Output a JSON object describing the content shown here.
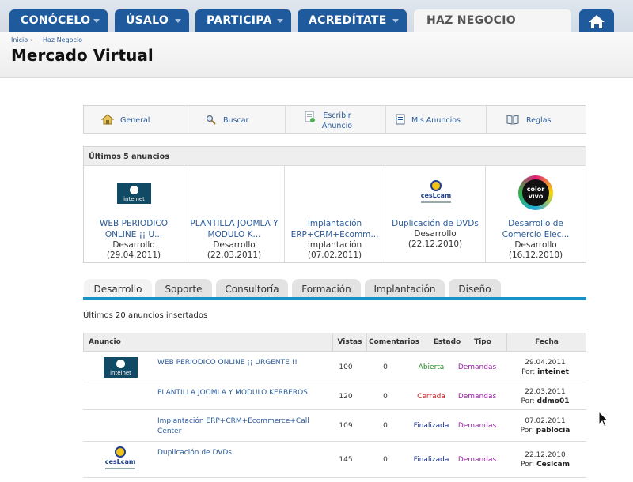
{
  "nav": {
    "tabs": [
      {
        "label": "CONÓCELO"
      },
      {
        "label": "ÚSALO"
      },
      {
        "label": "PARTICIPA"
      },
      {
        "label": "ACREDÍTATE"
      },
      {
        "label": "HAZ NEGOCIO"
      }
    ],
    "home_icon": "home-icon"
  },
  "breadcrumb": [
    "Inicio",
    "Haz Negocio"
  ],
  "page_title": "Mercado Virtual",
  "toolbar": {
    "items": [
      {
        "label": "General",
        "icon": "home-icon"
      },
      {
        "label": "Buscar",
        "icon": "magnifier-icon"
      },
      {
        "label": "Escribir Anuncio",
        "icon": "write-icon"
      },
      {
        "label": "Mis Anuncios",
        "icon": "my-ads-icon"
      },
      {
        "label": "Reglas",
        "icon": "book-icon"
      }
    ]
  },
  "latest": {
    "heading": "Últimos 5 anuncios",
    "cards": [
      {
        "title_l1": "WEB PERIODICO",
        "title_l2": "ONLINE ¡¡ U...",
        "category": "Desarrollo",
        "date": "(29.04.2011)",
        "logo": "inteinet",
        "logo_text": "inteinet"
      },
      {
        "title_l1": "PLANTILLA JOOMLA Y",
        "title_l2": "MODULO K...",
        "category": "Desarrollo",
        "date": "(22.03.2011)",
        "logo": "none"
      },
      {
        "title_l1": "Implantación",
        "title_l2": "ERP+CRM+Ecomm...",
        "category": "Implantación",
        "date": "(07.02.2011)",
        "logo": "none"
      },
      {
        "title_l1": "Duplicación de DVDs",
        "title_l2": "",
        "category": "Desarrollo",
        "date": "(22.12.2010)",
        "logo": "ceslcam",
        "logo_text": "cesLcam"
      },
      {
        "title_l1": "Desarrollo de",
        "title_l2": "Comercio Elec...",
        "category": "Desarrollo",
        "date": "(16.12.2010)",
        "logo": "colorvivo",
        "logo_text": "color vivo"
      }
    ]
  },
  "category_tabs": [
    {
      "label": "Desarrollo"
    },
    {
      "label": "Soporte"
    },
    {
      "label": "Consultoría"
    },
    {
      "label": "Formación"
    },
    {
      "label": "Implantación"
    },
    {
      "label": "Diseño"
    }
  ],
  "table": {
    "caption": "Últimos 20 anuncios insertados",
    "headers": [
      "Anuncio",
      "Vistas",
      "Comentarios",
      "Estado",
      "Tipo",
      "Fecha"
    ],
    "rows": [
      {
        "title_l1": "WEB PERIODICO ONLINE ¡¡ URGENTE !!",
        "title_l2": "",
        "views": "100",
        "comments": "0",
        "status": "Abierta",
        "status_color": "#1c8a1c",
        "type": "Demandas",
        "date": "29.04.2011",
        "by_label": "Por:",
        "by": "inteinet",
        "logo": "inteinet",
        "logo_text": "inteinet"
      },
      {
        "title_l1": "PLANTILLA JOOMLA Y MODULO KERBEROS",
        "title_l2": "",
        "views": "120",
        "comments": "0",
        "status": "Cerrada",
        "status_color": "#cc2020",
        "type": "Demandas",
        "date": "22.03.2011",
        "by_label": "Por:",
        "by": "ddmo01",
        "logo": "none"
      },
      {
        "title_l1": "Implantación ERP+CRM+Ecommerce+Call",
        "title_l2": "Center",
        "views": "109",
        "comments": "0",
        "status": "Finalizada",
        "status_color": "#1a2fa0",
        "type": "Demandas",
        "date": "07.02.2011",
        "by_label": "Por:",
        "by": "pablocia",
        "logo": "none"
      },
      {
        "title_l1": "Duplicación de DVDs",
        "title_l2": "",
        "views": "145",
        "comments": "0",
        "status": "Finalizada",
        "status_color": "#1a2fa0",
        "type": "Demandas",
        "date": "22.12.2010",
        "by_label": "Por:",
        "by": "Ceslcam",
        "logo": "ceslcam",
        "logo_text": "cesLcam"
      }
    ]
  }
}
